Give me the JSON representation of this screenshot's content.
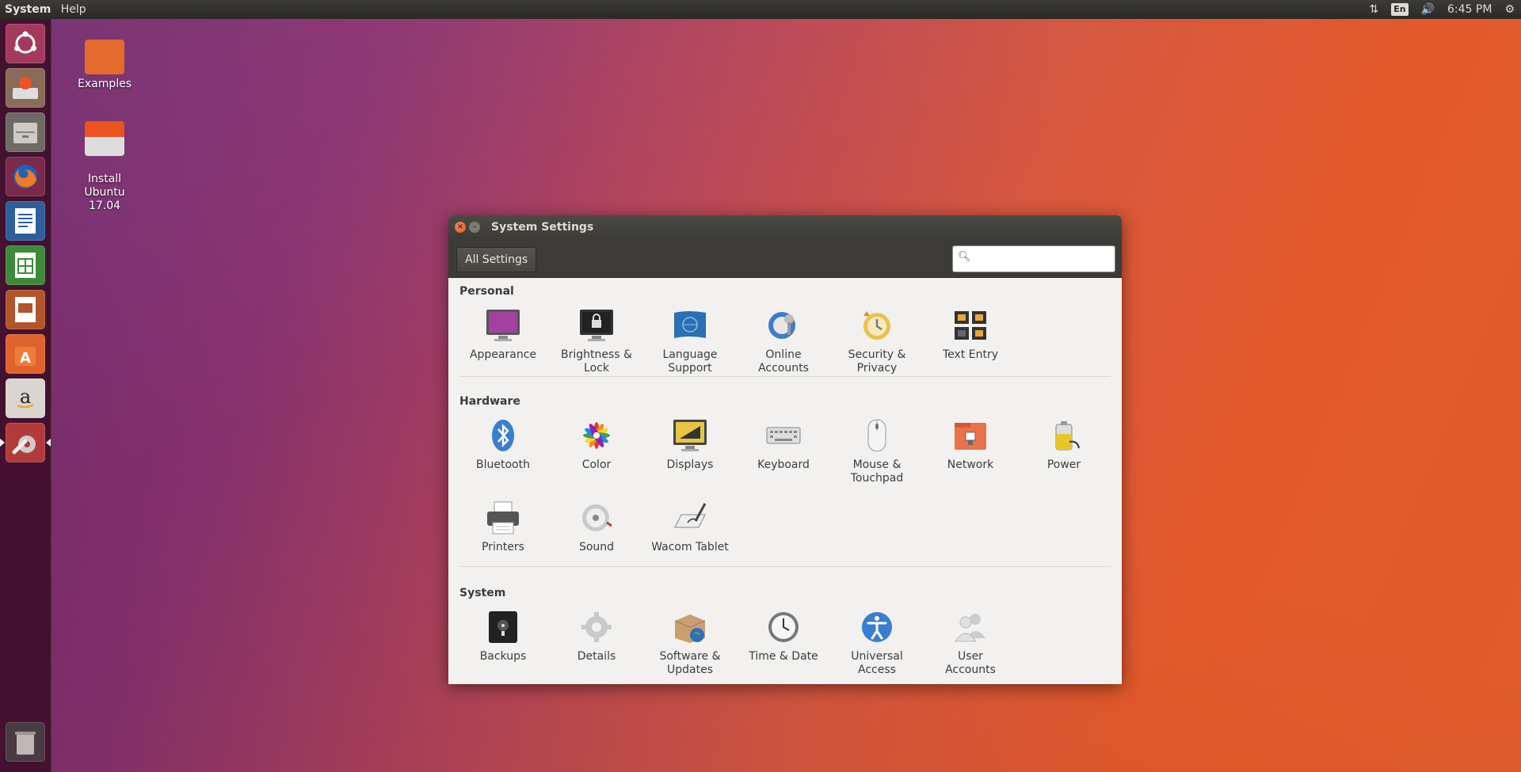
{
  "top_panel": {
    "menu": [
      "System",
      "Help"
    ],
    "indicators": {
      "keyboard": "En",
      "clock": "6:45 PM"
    }
  },
  "desktop": {
    "icons": [
      {
        "label": "Examples"
      },
      {
        "label": "Install\nUbuntu\n17.04"
      }
    ]
  },
  "launcher": {
    "items": [
      "ubuntu-dash",
      "installer",
      "files",
      "firefox",
      "libreoffice-writer",
      "libreoffice-calc",
      "libreoffice-impress",
      "ubuntu-software",
      "amazon",
      "system-settings",
      "trash"
    ]
  },
  "window": {
    "title": "System Settings",
    "all_settings_label": "All Settings",
    "search_placeholder": "",
    "sections": [
      {
        "title": "Personal",
        "items": [
          {
            "label": "Appearance",
            "icon": "appearance-icon"
          },
          {
            "label": "Brightness &\nLock",
            "icon": "brightness-lock-icon"
          },
          {
            "label": "Language\nSupport",
            "icon": "language-support-icon"
          },
          {
            "label": "Online\nAccounts",
            "icon": "online-accounts-icon"
          },
          {
            "label": "Security &\nPrivacy",
            "icon": "security-privacy-icon"
          },
          {
            "label": "Text Entry",
            "icon": "text-entry-icon"
          }
        ]
      },
      {
        "title": "Hardware",
        "items": [
          {
            "label": "Bluetooth",
            "icon": "bluetooth-icon"
          },
          {
            "label": "Color",
            "icon": "color-icon"
          },
          {
            "label": "Displays",
            "icon": "displays-icon"
          },
          {
            "label": "Keyboard",
            "icon": "keyboard-icon"
          },
          {
            "label": "Mouse &\nTouchpad",
            "icon": "mouse-icon"
          },
          {
            "label": "Network",
            "icon": "network-icon"
          },
          {
            "label": "Power",
            "icon": "power-icon"
          },
          {
            "label": "Printers",
            "icon": "printer-icon"
          },
          {
            "label": "Sound",
            "icon": "sound-icon"
          },
          {
            "label": "Wacom Tablet",
            "icon": "wacom-tablet-icon"
          }
        ]
      },
      {
        "title": "System",
        "items": [
          {
            "label": "Backups",
            "icon": "backups-icon"
          },
          {
            "label": "Details",
            "icon": "details-icon"
          },
          {
            "label": "Software &\nUpdates",
            "icon": "software-updates-icon"
          },
          {
            "label": "Time & Date",
            "icon": "time-date-icon"
          },
          {
            "label": "Universal\nAccess",
            "icon": "universal-access-icon"
          },
          {
            "label": "User\nAccounts",
            "icon": "user-accounts-icon"
          }
        ]
      }
    ]
  }
}
